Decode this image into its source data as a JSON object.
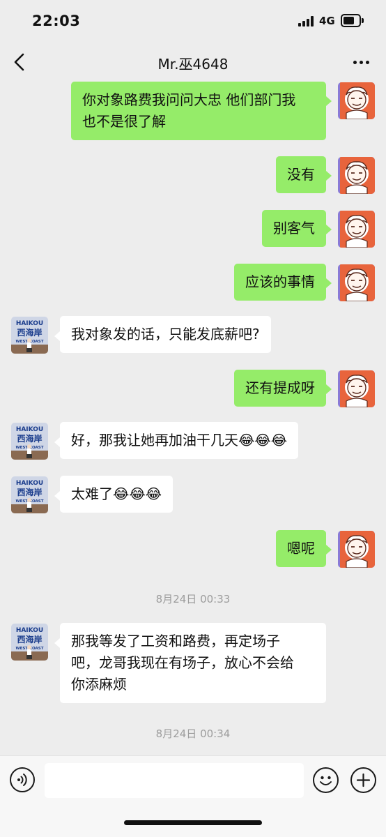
{
  "status": {
    "time": "22:03",
    "network": "4G"
  },
  "nav": {
    "title": "Mr.巫4648"
  },
  "messages": [
    {
      "from": "me",
      "lines": [
        "你对象路费我问问大忠 他们部门我",
        "也不是很了解"
      ]
    },
    {
      "from": "me",
      "lines": [
        "没有"
      ]
    },
    {
      "from": "me",
      "lines": [
        "别客气"
      ]
    },
    {
      "from": "me",
      "lines": [
        "应该的事情"
      ]
    },
    {
      "from": "other",
      "lines": [
        "我对象发的话，只能发底薪吧?"
      ]
    },
    {
      "from": "me",
      "lines": [
        "还有提成呀"
      ]
    },
    {
      "from": "other",
      "lines": [
        "好，那我让她再加油干几天😂😂😂"
      ]
    },
    {
      "from": "other",
      "lines": [
        "太难了😂😂😂"
      ]
    },
    {
      "from": "me",
      "lines": [
        "嗯呢"
      ]
    },
    {
      "from": "other",
      "lines": [
        "那我等发了工资和路费，再定场子",
        "吧，龙哥我现在有场子，放心不会给",
        "你添麻烦"
      ]
    }
  ],
  "timestamps": [
    "8月24日 00:33",
    "8月24日 00:34"
  ],
  "avatar_other": {
    "line1": "HAIKOU",
    "line2": "西海岸",
    "line3": "WEST COAST"
  },
  "colors": {
    "my_bubble": "#95ec69",
    "other_bubble": "#ffffff",
    "background": "#ededed",
    "avatar_orange": "#e8643c",
    "avatar_purple": "#8a7ad6"
  },
  "icons": {
    "back": "chevron-left-icon",
    "more": "more-dots-icon",
    "voice": "voice-icon",
    "emoji": "emoji-icon",
    "plus": "plus-icon"
  },
  "input": {
    "value": "",
    "placeholder": ""
  }
}
